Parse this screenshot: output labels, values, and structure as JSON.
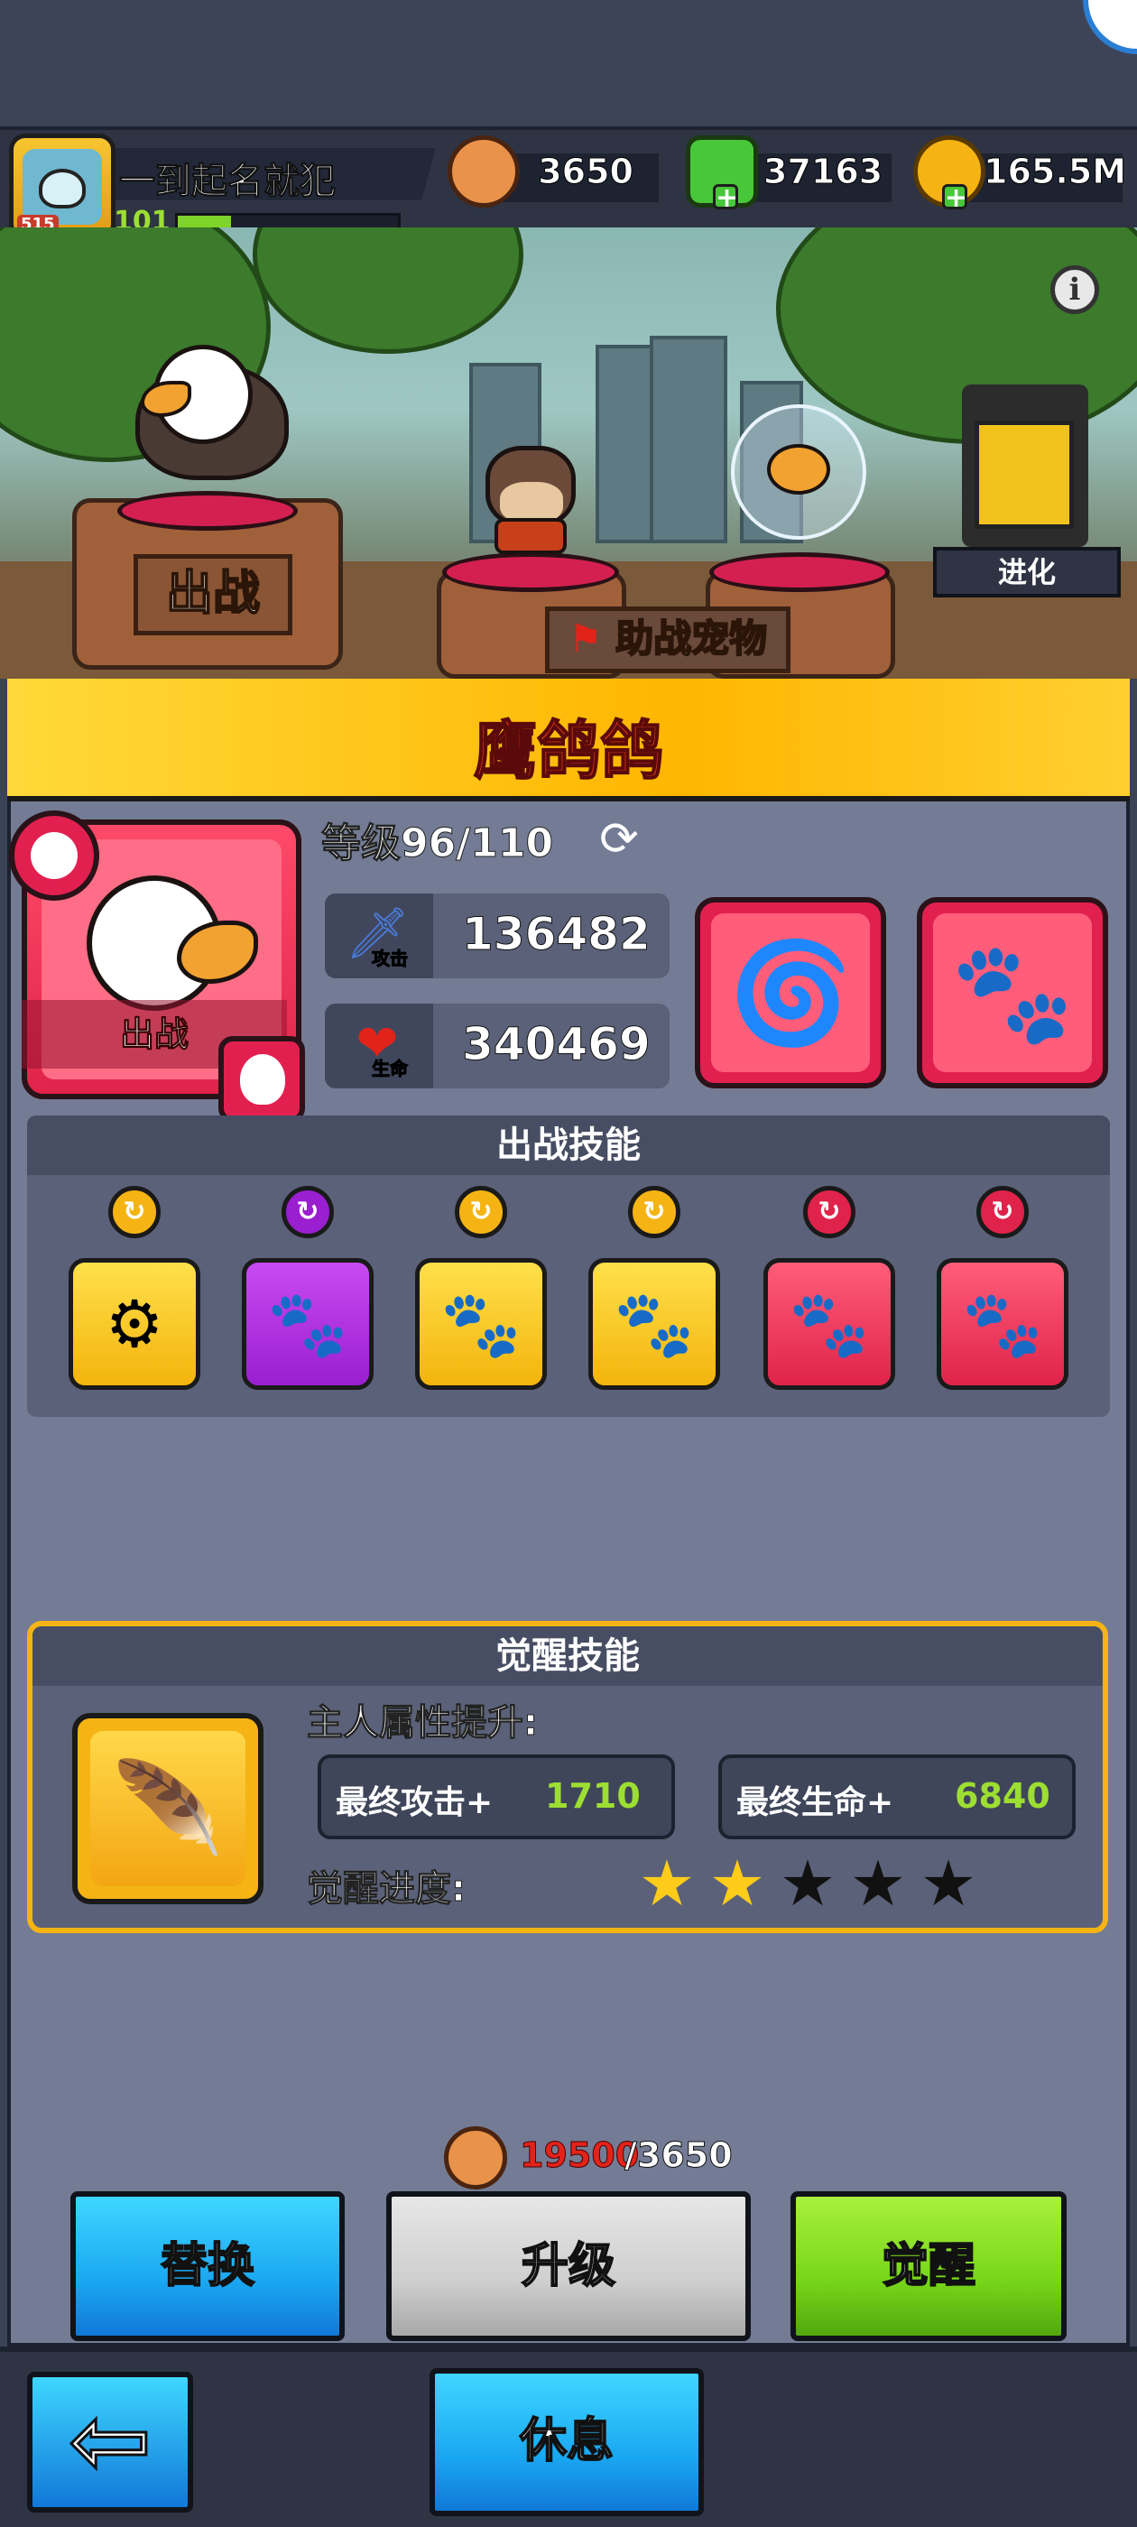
{
  "player": {
    "name": "一到起名就犯",
    "level": "101",
    "level_progress": 0.24,
    "avatar_badge": "515"
  },
  "resources": {
    "coins_a": "3650",
    "gems": "37163",
    "gold": "165.5M"
  },
  "scene": {
    "deploy_sign": "出战",
    "assist_sign": "助战宠物",
    "evolve_label": "进化",
    "info_icon": "info-icon"
  },
  "pet": {
    "name": "鹰鸽鸽",
    "card_label": "出战",
    "level_text": "等级96/110",
    "attack_sub": "攻击",
    "attack": "136482",
    "hp_sub": "生命",
    "hp": "340469"
  },
  "battle_skills": {
    "title": "出战技能",
    "tiles": [
      {
        "color": "yellow",
        "icon": "chest-gear-icon"
      },
      {
        "color": "purple",
        "icon": "paw-gear-icon"
      },
      {
        "color": "yellow",
        "icon": "paw-crab-icon"
      },
      {
        "color": "yellow",
        "icon": "paw-clock-icon"
      },
      {
        "color": "red",
        "icon": "paw-up-icon"
      },
      {
        "color": "red",
        "icon": "paw-heal-icon"
      }
    ]
  },
  "awaken": {
    "title": "觉醒技能",
    "attr_label": "主人属性提升:",
    "attack_name": "最终攻击+",
    "attack_val": "1710",
    "hp_name": "最终生命+",
    "hp_val": "6840",
    "progress_label": "觉醒进度:",
    "stars_filled": 2,
    "stars_total": 5
  },
  "cost": {
    "need": "19500",
    "have": "/3650"
  },
  "buttons": {
    "replace": "替换",
    "upgrade": "升级",
    "awaken": "觉醒",
    "rest": "休息"
  },
  "colors": {
    "title_red": "#e43a1a",
    "panel": "#737c94",
    "green_value": "#9dde32"
  }
}
